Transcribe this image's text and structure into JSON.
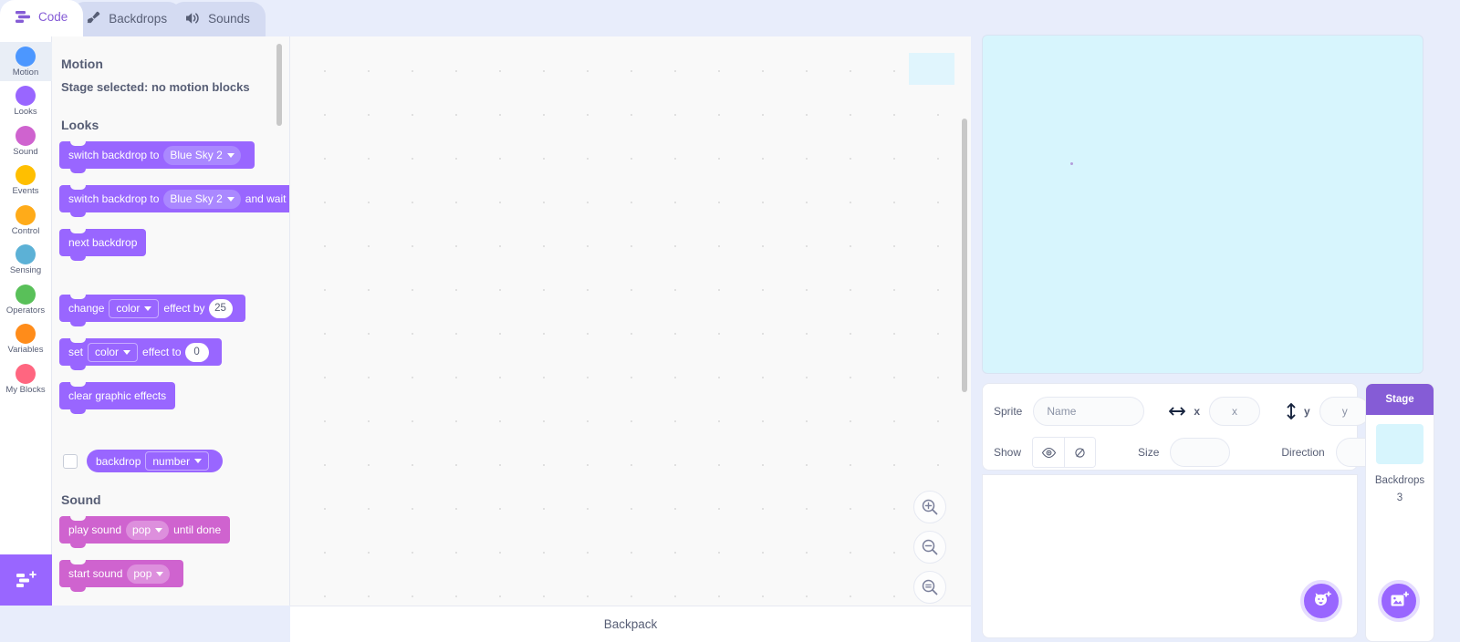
{
  "tabs": [
    {
      "label": "Code",
      "icon": "code-icon",
      "active": true
    },
    {
      "label": "Backdrops",
      "icon": "paintbrush-icon",
      "active": false
    },
    {
      "label": "Sounds",
      "icon": "speaker-icon",
      "active": false
    }
  ],
  "controls": {
    "green_flag": "green-flag-icon",
    "stop": "stop-sign-icon"
  },
  "stage_size": {
    "small_label": "small-stage-icon",
    "large_label": "large-stage-icon",
    "fullscreen_label": "fullscreen-icon",
    "selected": "large"
  },
  "categories": [
    {
      "label": "Motion",
      "color": "#4c97ff",
      "active": true
    },
    {
      "label": "Looks",
      "color": "#9966ff",
      "active": false
    },
    {
      "label": "Sound",
      "color": "#cf63cf",
      "active": false
    },
    {
      "label": "Events",
      "color": "#ffbf00",
      "active": false
    },
    {
      "label": "Control",
      "color": "#ffab19",
      "active": false
    },
    {
      "label": "Sensing",
      "color": "#5cb1d6",
      "active": false
    },
    {
      "label": "Operators",
      "color": "#59c059",
      "active": false
    },
    {
      "label": "Variables",
      "color": "#ff8c1a",
      "active": false
    },
    {
      "label": "My Blocks",
      "color": "#ff6680",
      "active": false
    }
  ],
  "extension_button": "add-extension-icon",
  "palette": {
    "motion_heading": "Motion",
    "motion_message": "Stage selected: no motion blocks",
    "looks_heading": "Looks",
    "sound_heading": "Sound",
    "blocks": {
      "switch_backdrop": {
        "text": "switch backdrop to",
        "value": "Blue Sky 2"
      },
      "switch_backdrop_wait": {
        "text": "switch backdrop to",
        "value": "Blue Sky 2",
        "suffix": "and wait"
      },
      "next_backdrop": {
        "text": "next backdrop"
      },
      "change_effect": {
        "text": "change",
        "value": "color",
        "mid": "effect by",
        "num": "25"
      },
      "set_effect": {
        "text": "set",
        "value": "color",
        "mid": "effect to",
        "num": "0"
      },
      "clear_effects": {
        "text": "clear graphic effects"
      },
      "backdrop_reporter": {
        "text": "backdrop",
        "value": "number"
      },
      "play_sound_until_done": {
        "text": "play sound",
        "value": "pop",
        "suffix": "until done"
      },
      "start_sound": {
        "text": "start sound",
        "value": "pop"
      }
    }
  },
  "workspace": {
    "zoom_in": "zoom-in-icon",
    "zoom_out": "zoom-out-icon",
    "zoom_reset": "zoom-reset-icon"
  },
  "backpack": {
    "label": "Backpack"
  },
  "sprite_info": {
    "sprite_label": "Sprite",
    "name_placeholder": "Name",
    "x_label": "x",
    "x_value": "x",
    "y_label": "y",
    "y_value": "y",
    "show_label": "Show",
    "show_icon": "eye-icon",
    "hide_icon": "eye-crossed-icon",
    "size_label": "Size",
    "size_value": "",
    "direction_label": "Direction",
    "direction_value": ""
  },
  "stage_panel": {
    "title": "Stage",
    "backdrops_label": "Backdrops",
    "backdrops_count": "3"
  },
  "fabs": {
    "choose_sprite": "choose-sprite-icon",
    "choose_backdrop": "choose-backdrop-icon"
  }
}
